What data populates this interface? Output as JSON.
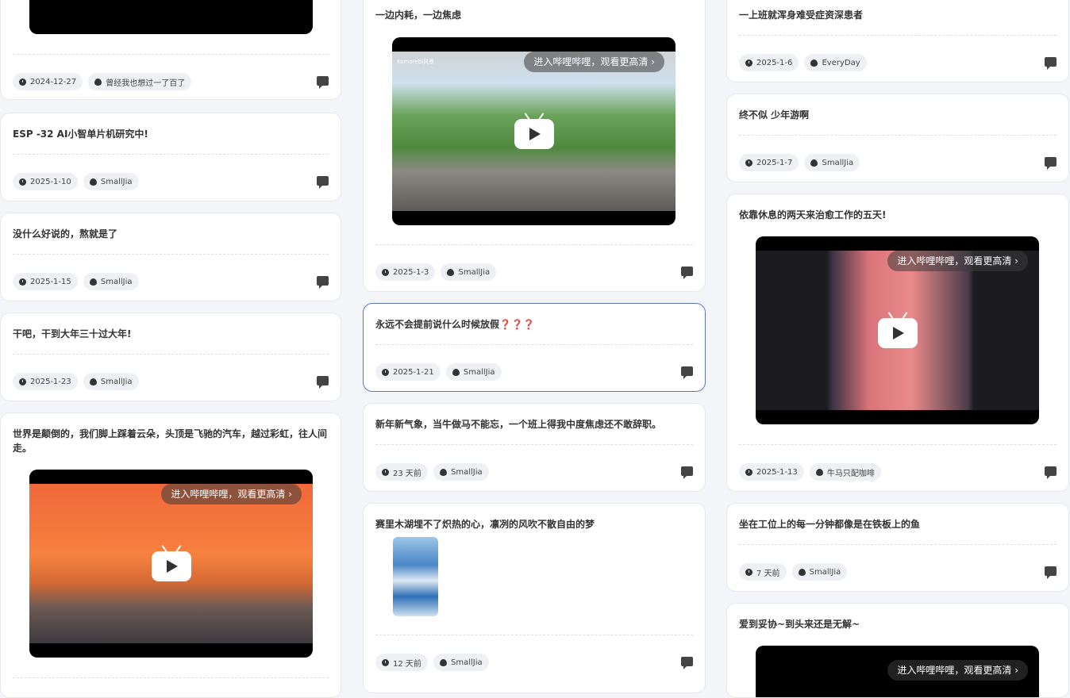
{
  "video_banner": "进入哔哩哔哩，观看更高清 ›",
  "video_watermark": "Komorebi风景",
  "icons": {
    "date": "clock-icon",
    "author": "flame-icon",
    "comment": "comment-icon"
  },
  "col1": [
    {
      "date": "2024-12-27",
      "author": "曾经我也想过一了百了"
    },
    {
      "title": "ESP -32 AI小智单片机研究中!",
      "date": "2025-1-10",
      "author": "SmallJia"
    },
    {
      "title": "没什么好说的，熬就是了",
      "date": "2025-1-15",
      "author": "SmallJia"
    },
    {
      "title": "干吧，干到大年三十过大年!",
      "date": "2025-1-23",
      "author": "SmallJia"
    },
    {
      "title": "世界是颠倒的，我们脚上踩着云朵，头顶是飞驰的汽车，越过彩虹，往人间走。"
    }
  ],
  "col2": [
    {
      "title": "一边内耗，一边焦虑",
      "date": "2025-1-3",
      "author": "SmallJia"
    },
    {
      "title": "永远不会提前说什么时候放假❓❓❓",
      "date": "2025-1-21",
      "author": "SmallJia"
    },
    {
      "title": "新年新气象，当牛做马不能忘，一个班上得我中度焦虑还不敢辞职。",
      "date": "23 天前",
      "author": "SmallJia"
    },
    {
      "title": "赛里木湖埋不了炽热的心，凛冽的风吹不散自由的梦",
      "date": "12 天前",
      "author": "SmallJia"
    }
  ],
  "col3": [
    {
      "title": "一上班就浑身难受症资深患者",
      "date": "2025-1-6",
      "author": "EveryDay"
    },
    {
      "title": "终不似 少年游啊",
      "date": "2025-1-7",
      "author": "SmallJia"
    },
    {
      "title": "依靠休息的两天来治愈工作的五天!",
      "date": "2025-1-13",
      "author": "牛马只配咖啡"
    },
    {
      "title": "坐在工位上的每一分钟都像是在铁板上的鱼",
      "date": "7 天前",
      "author": "SmallJia"
    },
    {
      "title": "爱到妥协~到头来还是无解~"
    }
  ]
}
